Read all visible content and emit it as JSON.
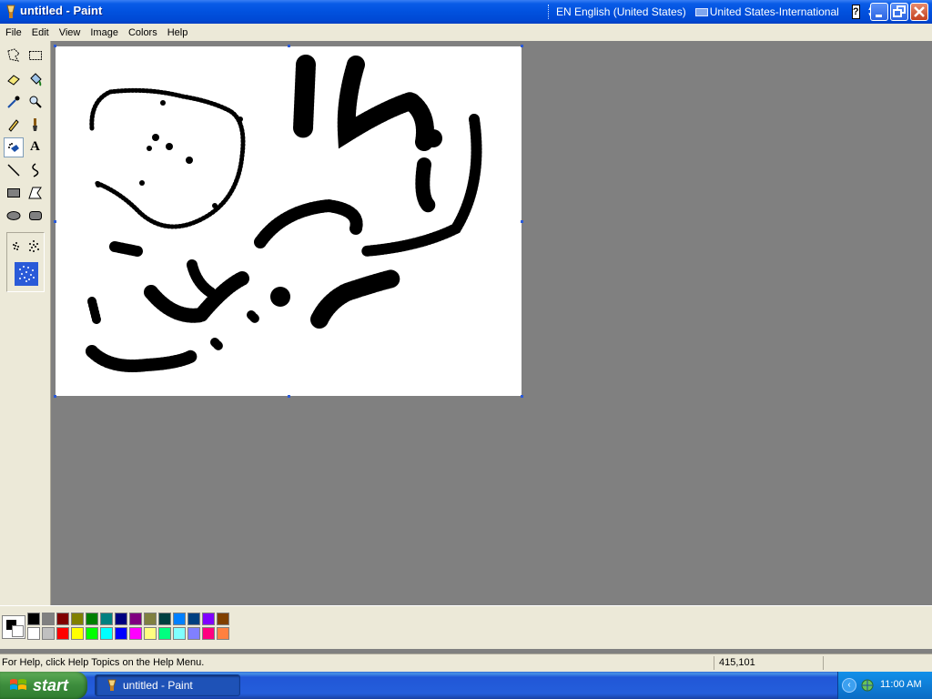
{
  "window": {
    "title": "untitled - Paint"
  },
  "language_bar": {
    "language": "EN English (United States)",
    "keyboard": "United States-International",
    "help": "?"
  },
  "menu": [
    "File",
    "Edit",
    "View",
    "Image",
    "Colors",
    "Help"
  ],
  "tools": [
    {
      "name": "free-form-select",
      "icon": "free-form-select-icon"
    },
    {
      "name": "select",
      "icon": "select-icon"
    },
    {
      "name": "eraser",
      "icon": "eraser-icon"
    },
    {
      "name": "fill-with-color",
      "icon": "fill-icon"
    },
    {
      "name": "pick-color",
      "icon": "eyedropper-icon"
    },
    {
      "name": "magnifier",
      "icon": "magnifier-icon"
    },
    {
      "name": "pencil",
      "icon": "pencil-icon"
    },
    {
      "name": "brush",
      "icon": "brush-icon"
    },
    {
      "name": "airbrush",
      "icon": "airbrush-icon",
      "selected": true
    },
    {
      "name": "text",
      "icon": "text-icon",
      "label": "A"
    },
    {
      "name": "line",
      "icon": "line-icon"
    },
    {
      "name": "curve",
      "icon": "curve-icon"
    },
    {
      "name": "rectangle",
      "icon": "rectangle-icon"
    },
    {
      "name": "polygon",
      "icon": "polygon-icon"
    },
    {
      "name": "ellipse",
      "icon": "ellipse-icon"
    },
    {
      "name": "rounded-rectangle",
      "icon": "rounded-rectangle-icon"
    }
  ],
  "colors": {
    "foreground": "#000000",
    "background": "#ffffff",
    "palette_top": [
      "#000000",
      "#808080",
      "#800000",
      "#808000",
      "#008000",
      "#008080",
      "#000080",
      "#800080",
      "#808040",
      "#004040",
      "#0080ff",
      "#004080",
      "#8000ff",
      "#804000"
    ],
    "palette_bottom": [
      "#ffffff",
      "#c0c0c0",
      "#ff0000",
      "#ffff00",
      "#00ff00",
      "#00ffff",
      "#0000ff",
      "#ff00ff",
      "#ffff80",
      "#00ff80",
      "#80ffff",
      "#8080ff",
      "#ff0080",
      "#ff8040"
    ]
  },
  "status": {
    "help": "For Help, click Help Topics on the Help Menu.",
    "coords": "415,101"
  },
  "taskbar": {
    "start": "start",
    "task": "untitled - Paint",
    "clock": "11:00 AM"
  }
}
